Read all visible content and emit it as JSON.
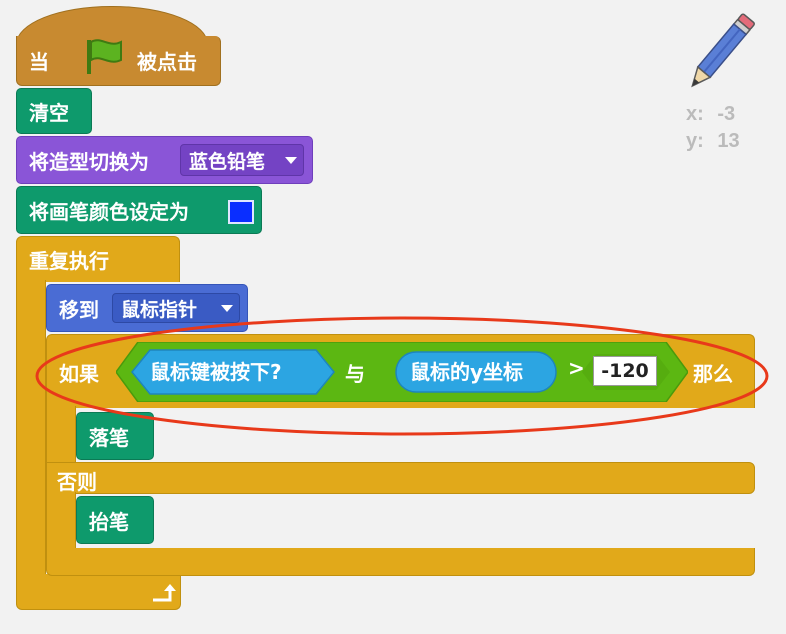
{
  "script": {
    "hat": {
      "when": "当",
      "clicked": "被点击",
      "flag_icon": "green-flag-icon"
    },
    "clear": "清空",
    "switch_costume": {
      "label": "将造型切换为",
      "value": "蓝色铅笔"
    },
    "set_pen_color": {
      "label": "将画笔颜色设定为",
      "color": "#0a2eff"
    },
    "forever": "重复执行",
    "go_to": {
      "label": "移到",
      "value": "鼠标指针"
    },
    "if_else": {
      "if_label": "如果",
      "mouse_down": "鼠标键被按下?",
      "and": "与",
      "mouse_y": "鼠标的y坐标",
      "gt": ">",
      "number": "-120",
      "then": "那么",
      "else_label": "否则"
    },
    "pen_down": "落笔",
    "pen_up": "抬笔"
  },
  "sprite_info": {
    "x_label": "x:",
    "x": "-3",
    "y_label": "y:",
    "y": "13",
    "icon": "pencil-icon"
  },
  "colors": {
    "events": "#c88a30",
    "pen": "#0e9a6c",
    "looks": "#8a55d7",
    "motion": "#4a6cd4",
    "control": "#e1a91a",
    "operators": "#5cb712",
    "sensing": "#2ca5e2",
    "highlight": "#e8391a"
  }
}
